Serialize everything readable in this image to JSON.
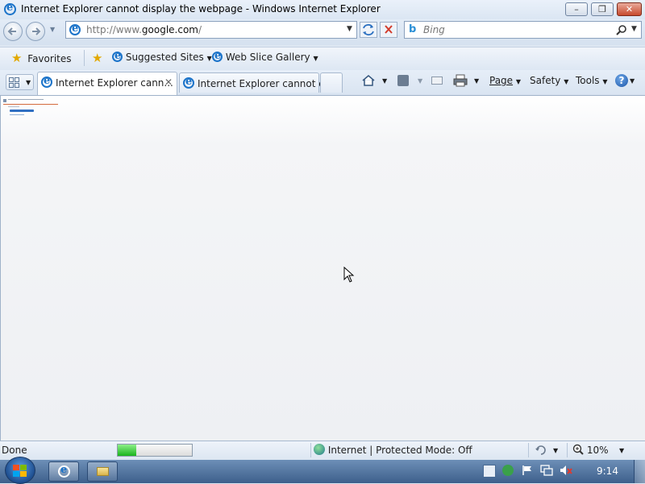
{
  "window": {
    "title": "Internet Explorer cannot display the webpage - Windows Internet Explorer",
    "minimize": "–",
    "maximize": "❐",
    "close": "✕"
  },
  "address_bar": {
    "url": "http://www.google.com/",
    "url_prefix": "http://www.",
    "url_host": "google.com",
    "url_suffix": "/"
  },
  "search": {
    "placeholder": "Bing"
  },
  "favorites_bar": {
    "favorites_label": "Favorites",
    "items": [
      {
        "label": "Suggested Sites"
      },
      {
        "label": "Web Slice Gallery"
      }
    ]
  },
  "tabs": [
    {
      "label": "Internet Explorer cann...",
      "active": true
    },
    {
      "label": "Internet Explorer cannot d...",
      "active": false
    }
  ],
  "command_bar": {
    "page": "Page",
    "safety": "Safety",
    "tools": "Tools"
  },
  "status_bar": {
    "status": "Done",
    "progress": 0.25,
    "zone": "Internet | Protected Mode: Off",
    "zoom": "10%"
  },
  "taskbar": {
    "clock": "9:14"
  },
  "colors": {
    "accent": "#1b73c9",
    "progress": "#19b41c",
    "close": "#c74a2d"
  }
}
